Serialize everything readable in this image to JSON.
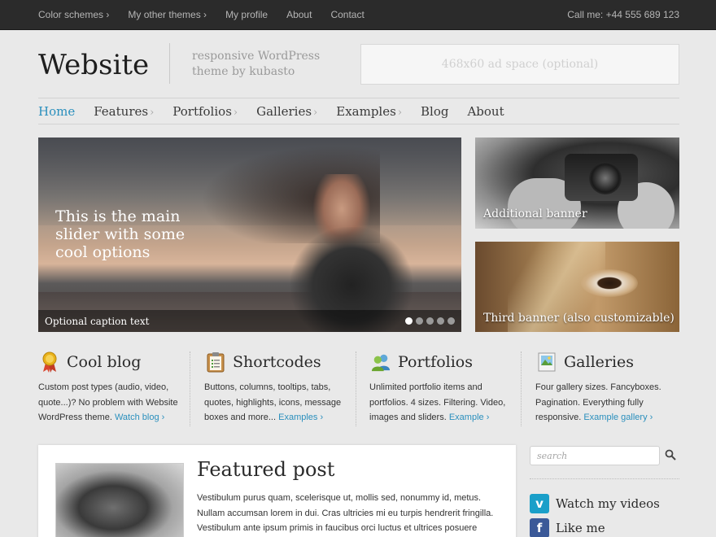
{
  "topbar": {
    "links": [
      {
        "label": "Color schemes ›"
      },
      {
        "label": "My other themes ›"
      },
      {
        "label": "My profile"
      },
      {
        "label": "About"
      },
      {
        "label": "Contact"
      }
    ],
    "phone": "Call me: +44 555 689 123"
  },
  "header": {
    "logo": "Website",
    "tagline": "responsive WordPress theme by kubasto",
    "ad_space": "468x60 ad space (optional)"
  },
  "nav": {
    "items": [
      {
        "label": "Home",
        "chevron": ""
      },
      {
        "label": "Features",
        "chevron": "›"
      },
      {
        "label": "Portfolios",
        "chevron": "›"
      },
      {
        "label": "Galleries",
        "chevron": "›"
      },
      {
        "label": "Examples",
        "chevron": "›"
      },
      {
        "label": "Blog",
        "chevron": ""
      },
      {
        "label": "About",
        "chevron": ""
      }
    ],
    "active_color": "#2a8fbd"
  },
  "slider": {
    "headline": "This is the main slider with some cool options",
    "caption": "Optional caption text",
    "slide_count": 5,
    "active_slide": 1
  },
  "banners": [
    {
      "text": "Additional banner"
    },
    {
      "text": "Third banner (also customizable)"
    }
  ],
  "features": [
    {
      "icon": "award-ribbon-icon",
      "title": "Cool blog",
      "body": "Custom post types (audio, video, quote...)? No problem with Website WordPress theme.",
      "link": "Watch blog ›"
    },
    {
      "icon": "clipboard-icon",
      "title": "Shortcodes",
      "body": "Buttons, columns, tooltips, tabs, quotes, highlights, icons, message boxes and more...",
      "link": "Examples ›"
    },
    {
      "icon": "users-icon",
      "title": "Portfolios",
      "body": "Unlimited portfolio items and portfolios. 4 sizes. Filtering. Video, images and sliders.",
      "link": "Example ›"
    },
    {
      "icon": "image-icon",
      "title": "Galleries",
      "body": "Four gallery sizes. Fancyboxes. Pagination. Everything fully responsive.",
      "link": "Example gallery ›"
    }
  ],
  "featured_post": {
    "title": "Featured post",
    "body": "Vestibulum purus quam, scelerisque ut, mollis sed, nonummy id, metus. Nullam accumsan lorem in dui. Cras ultricies mi eu turpis hendrerit fringilla. Vestibulum ante ipsum primis in faucibus orci luctus et ultrices posuere cubilia Curae; In ac"
  },
  "sidebar": {
    "search_placeholder": "search",
    "social": [
      {
        "icon": "vimeo-icon",
        "glyph": "v",
        "label": "Watch my videos"
      },
      {
        "icon": "facebook-icon",
        "glyph": "f",
        "label": "Like me"
      }
    ]
  },
  "colors": {
    "accent": "#2a8fbd",
    "topbar": "#2b2b2b",
    "background": "#e9e9e9"
  }
}
